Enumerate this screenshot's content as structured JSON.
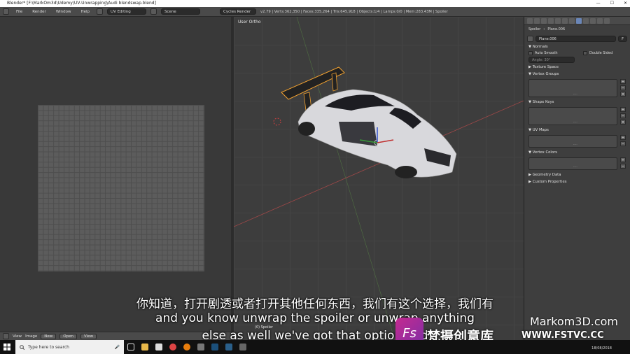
{
  "window": {
    "title": "Blender* [F:\\MarkOm3d\\Udemy\\UV-Unwrapping\\Audi blendswap.blend]",
    "controls": [
      "—",
      "☐",
      "✕"
    ]
  },
  "topbar": {
    "menus": [
      "File",
      "Render",
      "Window",
      "Help"
    ],
    "layout": "UV Editing",
    "scene": "Scene",
    "engine": "Cycles Render",
    "stats": "v2.79 | Verts:362,350 | Faces:335,264 | Tris:645,918 | Objects:1/4 | Lamps:0/0 | Mem:283.43M | Spoiler"
  },
  "uv_editor": {
    "header": {
      "menus": [
        "View",
        "Image"
      ],
      "new_label": "New",
      "open_label": "Open",
      "view_label": "View"
    }
  },
  "viewport": {
    "view_name": "User Ortho",
    "object_label": "(0) Spoiler"
  },
  "properties": {
    "breadcrumb": [
      "Spoiler",
      "Plane.006"
    ],
    "data_name": "Plane.006",
    "fake_user": "F",
    "sections": {
      "normals": "Normals",
      "auto_smooth": "Auto Smooth",
      "double_sided": "Double Sided",
      "angle": "Angle: 30°",
      "texture_space": "Texture Space",
      "vertex_groups": "Vertex Groups",
      "shape_keys": "Shape Keys",
      "uv_maps": "UV Maps",
      "vertex_colors": "Vertex Colors",
      "geometry_data": "Geometry Data",
      "custom_properties": "Custom Properties"
    },
    "list_dots": "...."
  },
  "subtitles": {
    "cn": "你知道，打开剧透或者打开其他任何东西，我们有这个选择，我们有",
    "en1": "and you know unwrap the spoiler or unwrap anything",
    "en2": "else as well we've got that option and"
  },
  "watermarks": {
    "channel": "Markom3D.com",
    "logo_letter": "Fs",
    "cn_brand": "梵摄创意库",
    "url": "WWW.FSTVC.CC"
  },
  "taskbar": {
    "search_placeholder": "Type here to search",
    "date": "18/08/2018"
  },
  "colors": {
    "spoiler_outline": "#f0a030",
    "car_body": "#d8d8dc",
    "axis_red": "#c04040",
    "axis_green": "#5aa040"
  }
}
